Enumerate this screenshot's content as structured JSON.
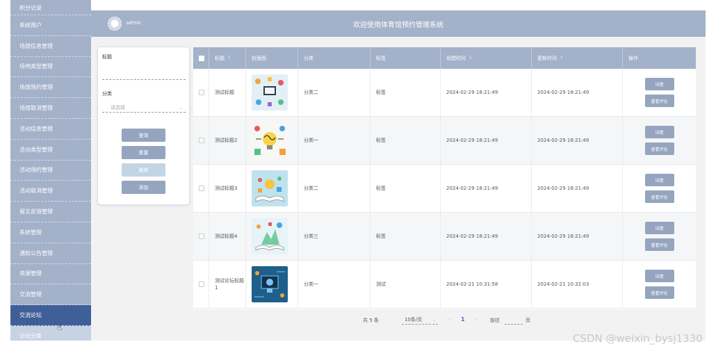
{
  "sidebar": {
    "items": [
      {
        "label": "积分记录"
      },
      {
        "label": "系统用户"
      },
      {
        "label": "场馆信息管理"
      },
      {
        "label": "场地类型管理"
      },
      {
        "label": "场馆预约管理"
      },
      {
        "label": "场馆取消管理"
      },
      {
        "label": "活动信息管理"
      },
      {
        "label": "活动类型管理"
      },
      {
        "label": "活动预约管理"
      },
      {
        "label": "活动取消管理"
      },
      {
        "label": "留言反馈管理"
      },
      {
        "label": "系统管理"
      },
      {
        "label": "通知公告管理"
      },
      {
        "label": "资源管理"
      },
      {
        "label": "交流管理"
      },
      {
        "label": "交流论坛"
      },
      {
        "label": "论坛分类"
      }
    ],
    "active_index": 15
  },
  "header": {
    "username": "admin",
    "title": "欢迎使用体育馆预约管理系统"
  },
  "search": {
    "title_label": "标题",
    "title_placeholder": "",
    "category_label": "分类",
    "category_placeholder": "请选择",
    "query_btn": "查询",
    "reset_btn": "重置",
    "delete_btn": "删除",
    "add_btn": "添加"
  },
  "table": {
    "headers": {
      "title": "标题",
      "cover": "封面图",
      "category": "分类",
      "tag": "标签",
      "created": "创建时间",
      "updated": "更新时间",
      "actions": "操作"
    },
    "rows": [
      {
        "title": "测试标题",
        "category": "分类二",
        "tag": "标签",
        "created": "2024-02-29 18:21:49",
        "updated": "2024-02-29 18:21:49",
        "btn1": "详情",
        "btn2": "重看评论"
      },
      {
        "title": "测试标题2",
        "category": "分类一",
        "tag": "标签",
        "created": "2024-02-29 18:21:49",
        "updated": "2024-02-29 18:21:49",
        "btn1": "详情",
        "btn2": "查看评论"
      },
      {
        "title": "测试标题3",
        "category": "分类二",
        "tag": "标签",
        "created": "2024-02-29 18:21:49",
        "updated": "2024-02-29 18:21:49",
        "btn1": "详情",
        "btn2": "查看评论"
      },
      {
        "title": "测试标题4",
        "category": "分类三",
        "tag": "标签",
        "created": "2024-02-29 18:21:49",
        "updated": "2024-02-29 18:21:49",
        "btn1": "详情",
        "btn2": "重看评论"
      },
      {
        "title": "测试论坛标题1",
        "category": "分类一",
        "tag": "测试",
        "created": "2024-02-21 10:31:58",
        "updated": "2024-02-21 10:32:03",
        "btn1": "详情",
        "btn2": "查看评论"
      }
    ]
  },
  "pager": {
    "total": "共 5 条",
    "page_size": "10条/页",
    "current": "1",
    "goto": "前往",
    "unit": "页"
  },
  "watermark": "CSDN @weixin_bysj1330",
  "colors": {
    "sidebar": "#a3b1c9",
    "active": "#3f5f99",
    "button": "#95a5c0",
    "button_disabled": "#c3d5e2"
  }
}
